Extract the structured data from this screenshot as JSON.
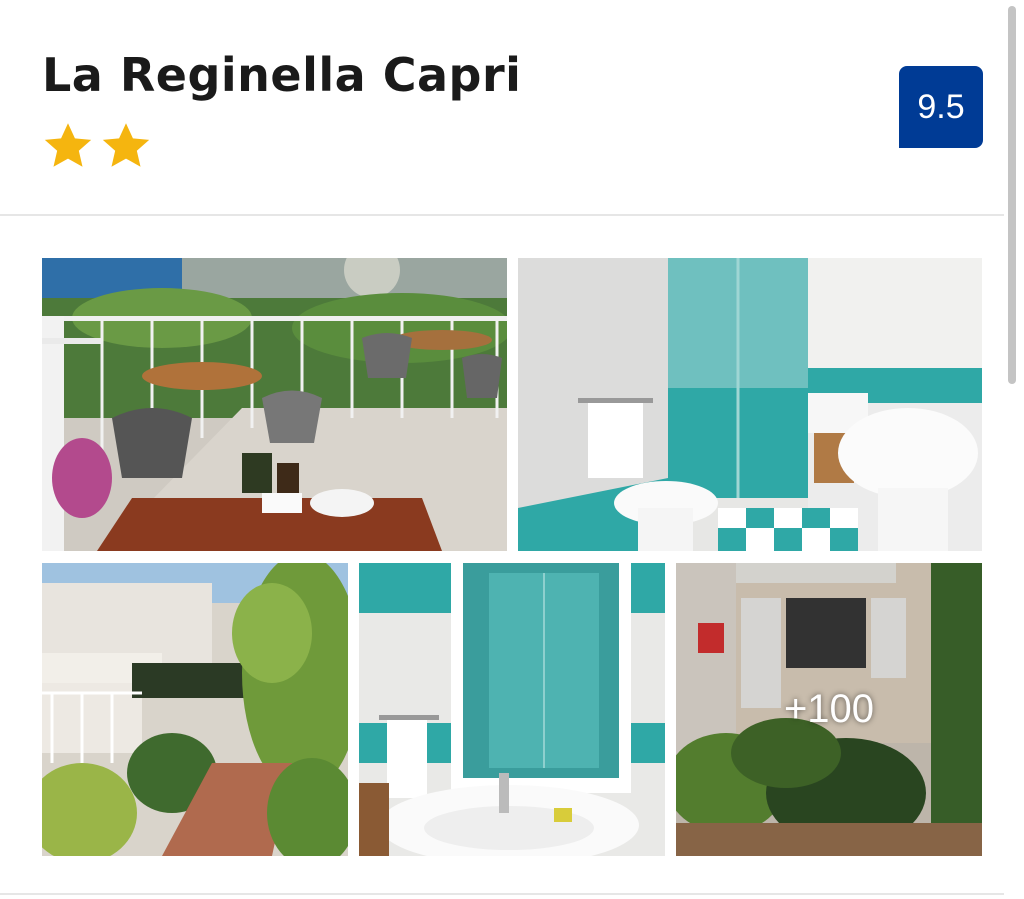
{
  "hotel": {
    "name": "La Reginella Capri",
    "star_count": 2,
    "review_score": "9.5"
  },
  "gallery": {
    "more_photos_label": "+100",
    "photos": [
      {
        "name": "terrace-photo",
        "subject": "terrace"
      },
      {
        "name": "bathroom-photo",
        "subject": "bathroom"
      },
      {
        "name": "garden-photo",
        "subject": "garden"
      },
      {
        "name": "washbasin-photo",
        "subject": "washbasin"
      },
      {
        "name": "patio-photo",
        "subject": "patio"
      }
    ]
  },
  "colors": {
    "star": "#f5b50f",
    "badge": "#003b95",
    "tile_teal": "#2fa8a6"
  },
  "icons": [
    "star-icon",
    "star-icon"
  ]
}
